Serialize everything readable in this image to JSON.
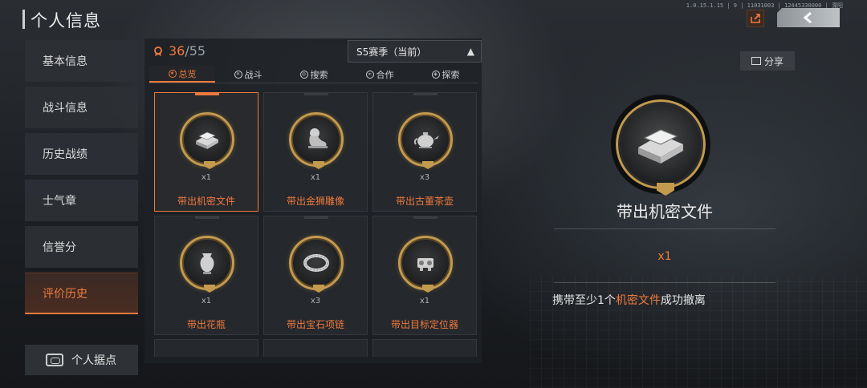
{
  "page": {
    "title": "个人信息",
    "build_info": "1.0.15.1.15 | 9 | 11031003 | 12445330000 | 溧阳"
  },
  "sidebar": {
    "items": [
      {
        "label": "基本信息",
        "active": false
      },
      {
        "label": "战斗信息",
        "active": false
      },
      {
        "label": "历史战绩",
        "active": false
      },
      {
        "label": "士气章",
        "active": false
      },
      {
        "label": "信誉分",
        "active": false
      },
      {
        "label": "评价历史",
        "active": true
      }
    ],
    "base_button": "个人据点"
  },
  "panel": {
    "count_current": "36",
    "count_total": "/55",
    "season": "S5赛季（当前）",
    "tabs": [
      {
        "label": "总览",
        "active": true
      },
      {
        "label": "战斗",
        "active": false
      },
      {
        "label": "搜索",
        "active": false
      },
      {
        "label": "合作",
        "active": false
      },
      {
        "label": "探索",
        "active": false
      }
    ],
    "cards": [
      {
        "icon": "document-icon",
        "qty": "x1",
        "label": "带出机密文件",
        "selected": true
      },
      {
        "icon": "sphinx-statue-icon",
        "qty": "x1",
        "label": "带出金狮雕像",
        "selected": false
      },
      {
        "icon": "teapot-icon",
        "qty": "x3",
        "label": "带出古董茶壶",
        "selected": false
      },
      {
        "icon": "vase-icon",
        "qty": "x1",
        "label": "带出花瓶",
        "selected": false
      },
      {
        "icon": "necklace-icon",
        "qty": "x3",
        "label": "带出宝石项链",
        "selected": false
      },
      {
        "icon": "locator-device-icon",
        "qty": "x1",
        "label": "带出目标定位器",
        "selected": false
      }
    ]
  },
  "detail": {
    "share_label": "分享",
    "title": "带出机密文件",
    "qty": "x1",
    "desc_prefix": "携带至少1个",
    "desc_highlight": "机密文件",
    "desc_suffix": "成功撤离"
  },
  "colors": {
    "accent": "#f07a3e",
    "gold": "#c39a4e"
  }
}
